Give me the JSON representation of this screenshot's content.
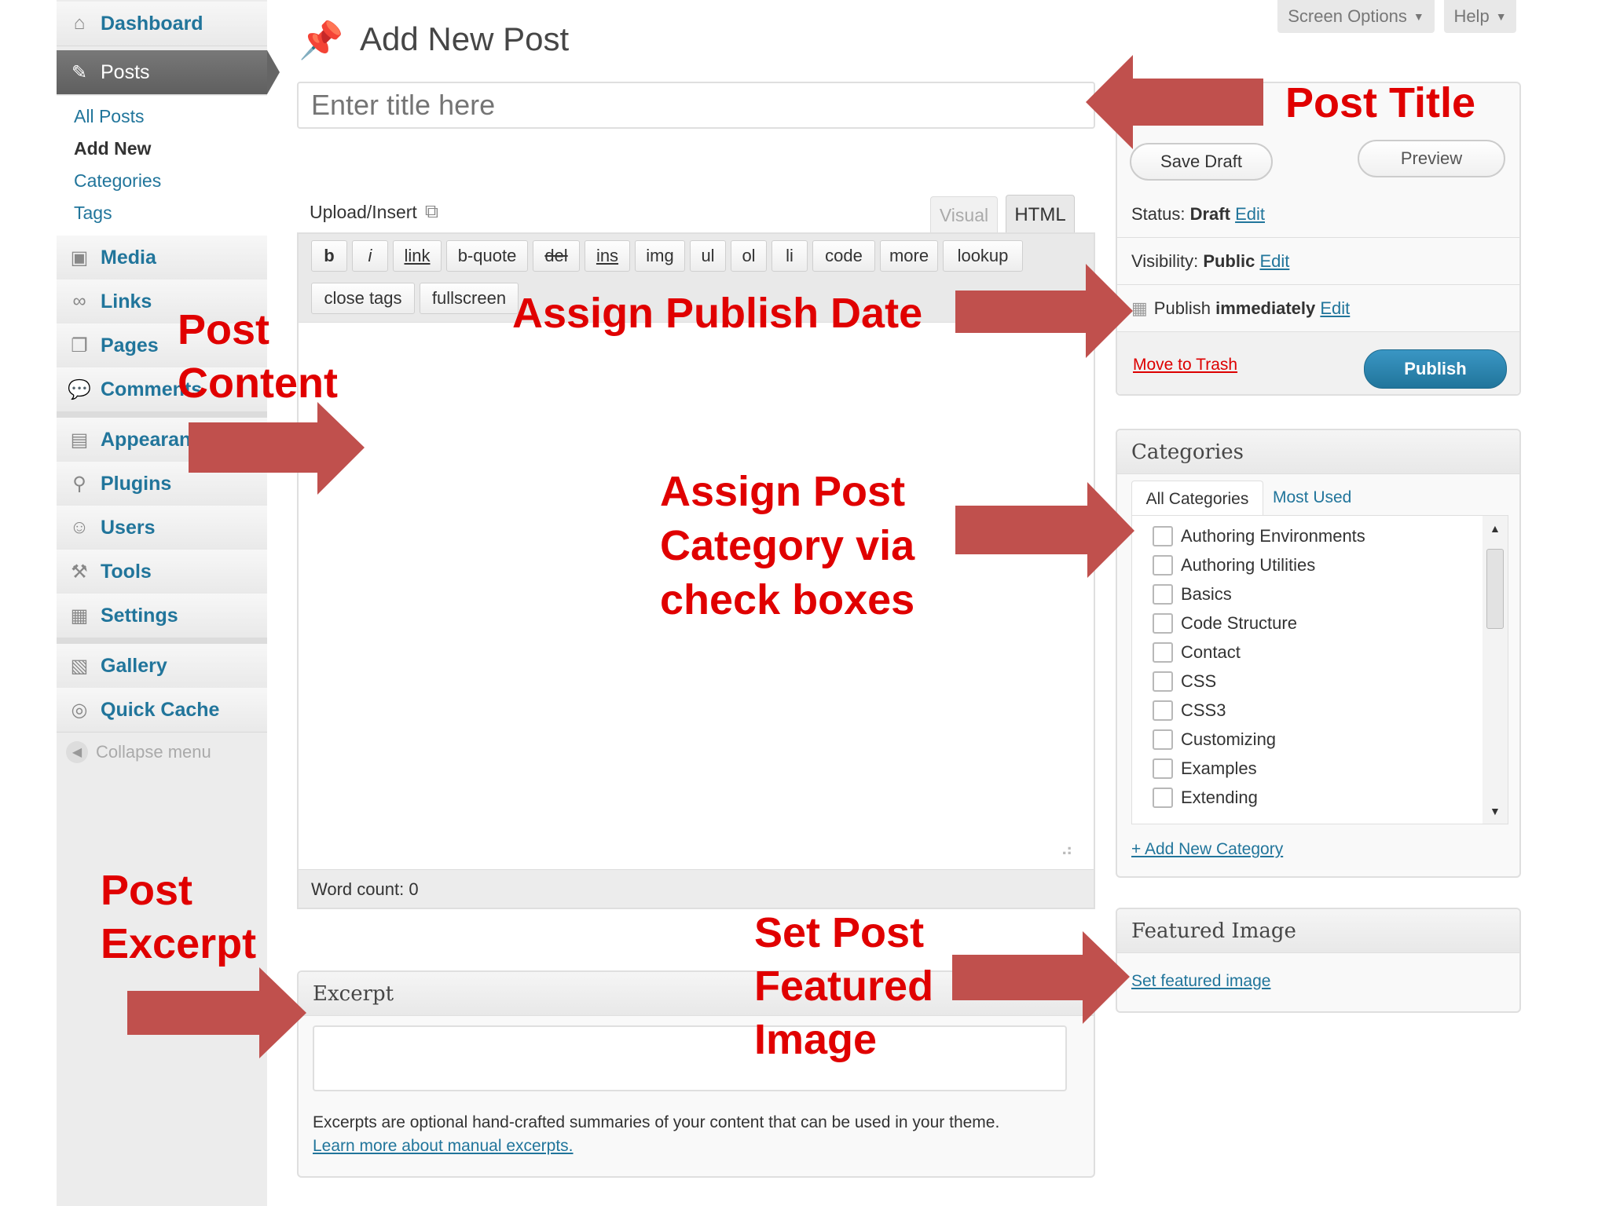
{
  "sidebar": {
    "dashboard": "Dashboard",
    "posts": "Posts",
    "posts_sub": [
      "All Posts",
      "Add New",
      "Categories",
      "Tags"
    ],
    "media": "Media",
    "links": "Links",
    "pages": "Pages",
    "comments": "Comments",
    "appearance": "Appearance",
    "plugins": "Plugins",
    "users": "Users",
    "tools": "Tools",
    "settings": "Settings",
    "gallery": "Gallery",
    "quick_cache": "Quick Cache",
    "collapse": "Collapse menu"
  },
  "header": {
    "page_title": "Add New Post",
    "screen_options": "Screen Options",
    "help": "Help"
  },
  "editor": {
    "title_placeholder": "Enter title here",
    "upload_insert": "Upload/Insert",
    "tab_visual": "Visual",
    "tab_html": "HTML",
    "quicktags": [
      "b",
      "i",
      "link",
      "b-quote",
      "del",
      "ins",
      "img",
      "ul",
      "ol",
      "li",
      "code",
      "more",
      "lookup"
    ],
    "quicktags_row2": [
      "close tags",
      "fullscreen"
    ],
    "word_count": "Word count: 0"
  },
  "excerpt": {
    "title": "Excerpt",
    "help_text": "Excerpts are optional hand-crafted summaries of your content that can be used in your theme.",
    "learn_more": "Learn more about manual excerpts."
  },
  "publish": {
    "save_draft": "Save Draft",
    "preview": "Preview",
    "status_label": "Status:",
    "status_value": "Draft",
    "visibility_label": "Visibility:",
    "visibility_value": "Public",
    "publish_label": "Publish",
    "publish_value": "immediately",
    "edit": "Edit",
    "move_to_trash": "Move to Trash",
    "publish_button": "Publish"
  },
  "categories": {
    "title": "Categories",
    "tab_all": "All Categories",
    "tab_most_used": "Most Used",
    "items": [
      "Authoring Environments",
      "Authoring Utilities",
      "Basics",
      "Code Structure",
      "Contact",
      "CSS",
      "CSS3",
      "Customizing",
      "Examples",
      "Extending"
    ],
    "add_new": "+ Add New Category"
  },
  "featured_image": {
    "title": "Featured Image",
    "link": "Set featured image"
  },
  "annotations": {
    "post_title": "Post Title",
    "publish_date": "Assign Publish Date",
    "post_content": [
      "Post",
      "Content"
    ],
    "category": [
      "Assign Post",
      "Category via",
      "check boxes"
    ],
    "excerpt": [
      "Post",
      "Excerpt"
    ],
    "featured": [
      "Set Post",
      "Featured",
      "Image"
    ]
  },
  "colors": {
    "link": "#21759b",
    "annotation_text": "#e00000",
    "arrow": "#c0504d",
    "publish_button": "#2583ad"
  }
}
